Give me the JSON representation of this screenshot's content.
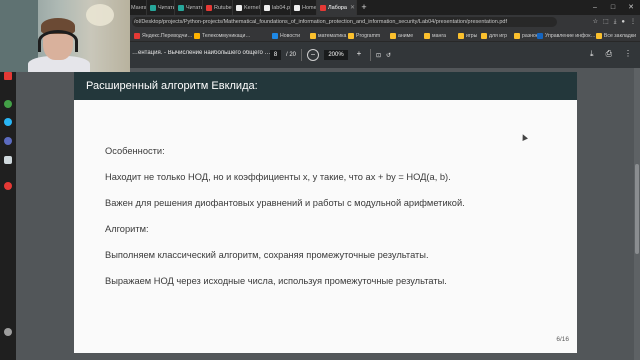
{
  "browser": {
    "tabs": [
      {
        "label": "Wikipedia",
        "color": "#d6d6d6",
        "active": false
      },
      {
        "label": "…ща",
        "color": "#9e9e9e",
        "active": false
      },
      {
        "label": "1089",
        "color": "#ff6a00",
        "active": false
      },
      {
        "label": "Москв",
        "color": "#1e88e5",
        "active": false
      },
      {
        "label": "Манга",
        "color": "#2196f3",
        "active": false
      },
      {
        "label": "Читать",
        "color": "#26a69a",
        "active": false
      },
      {
        "label": "Читать",
        "color": "#26a69a",
        "active": false
      },
      {
        "label": "Rutube",
        "color": "#e53935",
        "active": false
      },
      {
        "label": "Kernel",
        "color": "#eeeeee",
        "active": false
      },
      {
        "label": "lab04.p",
        "color": "#eeeeee",
        "active": false
      },
      {
        "label": "Home",
        "color": "#eeeeee",
        "active": false
      },
      {
        "label": "Лабора",
        "color": "#e53935",
        "active": true
      }
    ],
    "new_tab": "+",
    "url": "/ol/Desktop/projects/Python-projects/Mathematical_foundations_of_information_protection_and_information_security/Lab04/presentation/presentation.pdf",
    "bookmarks": [
      {
        "label": "Яндекс.Переводчи…",
        "color": "#e53935"
      },
      {
        "label": "Телекоммуникаци…",
        "color": "#ffb300"
      },
      {
        "label": "Новости",
        "color": "#1e88e5"
      },
      {
        "label": "математика",
        "color": "#fbc02d"
      },
      {
        "label": "Programm",
        "color": "#fbc02d"
      },
      {
        "label": "аниме",
        "color": "#fbc02d"
      },
      {
        "label": "манга",
        "color": "#fbc02d"
      },
      {
        "label": "игры",
        "color": "#fbc02d"
      },
      {
        "label": "для игр",
        "color": "#fbc02d"
      },
      {
        "label": "разное",
        "color": "#fbc02d"
      },
      {
        "label": "Управление инфок…",
        "color": "#1565c0"
      }
    ],
    "all_bookmarks": "Все закладки"
  },
  "pdf": {
    "title": "…ентация. - Вычисление наибольшего общего …",
    "page_current": "8",
    "page_total": "/ 20",
    "zoom": "200%",
    "zoom_out": "−",
    "zoom_in": "+"
  },
  "slide": {
    "title": "Расширенный алгоритм Евклида:",
    "lines": [
      "Особенности:",
      "Находит не только НОД, но и коэффициенты x, y такие, что ax + by = НОД(a, b).",
      "Важен для решения диофантовых уравнений и работы с модульной арифметикой.",
      "Алгоритм:",
      "Выполняем классический алгоритм, сохраняя промежуточные результаты.",
      "Выражаем НОД через исходные числа, используя промежуточные результаты."
    ],
    "page": "6/16",
    "header_color": "#23373b"
  },
  "icons": {
    "back": "arrow-left-icon",
    "download": "download-icon",
    "print": "print-icon",
    "more": "more-vert-icon",
    "fit": "fit-page-icon",
    "rotate": "rotate-icon"
  }
}
